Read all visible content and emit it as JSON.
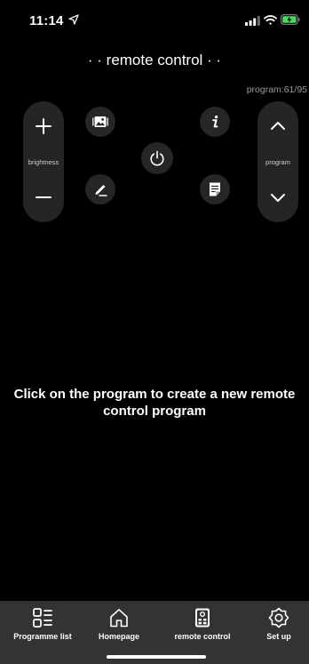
{
  "status_bar": {
    "time": "11:14",
    "icons": [
      "location-arrow-icon",
      "signal-icon",
      "wifi-icon",
      "battery-charging-icon"
    ],
    "battery_color": "#4cd964"
  },
  "header": {
    "title": "· · remote control · ·",
    "program_counter": "program:61/95"
  },
  "controls": {
    "brightness": {
      "up_icon": "plus-icon",
      "label": "brightness",
      "down_icon": "minus-icon"
    },
    "program": {
      "up_icon": "chevron-up-icon",
      "label": "program",
      "down_icon": "chevron-down-icon"
    },
    "buttons": [
      {
        "name": "picture-button",
        "icon": "picture-icon"
      },
      {
        "name": "edit-button",
        "icon": "pencil-icon"
      },
      {
        "name": "power-button",
        "icon": "power-icon"
      },
      {
        "name": "info-button",
        "icon": "info-icon"
      },
      {
        "name": "notes-button",
        "icon": "document-icon"
      }
    ]
  },
  "main": {
    "empty_message": "Click on the program to create a new remote control program"
  },
  "tab_bar": {
    "tabs": [
      {
        "label": "Programme list",
        "icon": "grid-list-icon"
      },
      {
        "label": "Homepage",
        "icon": "home-icon"
      },
      {
        "label": "remote control",
        "icon": "remote-icon"
      },
      {
        "label": "Set up",
        "icon": "gear-icon"
      }
    ]
  },
  "colors": {
    "background": "#000000",
    "button_surface": "#252525",
    "tab_bar": "#333333",
    "counter_text": "#9a9a9a"
  }
}
